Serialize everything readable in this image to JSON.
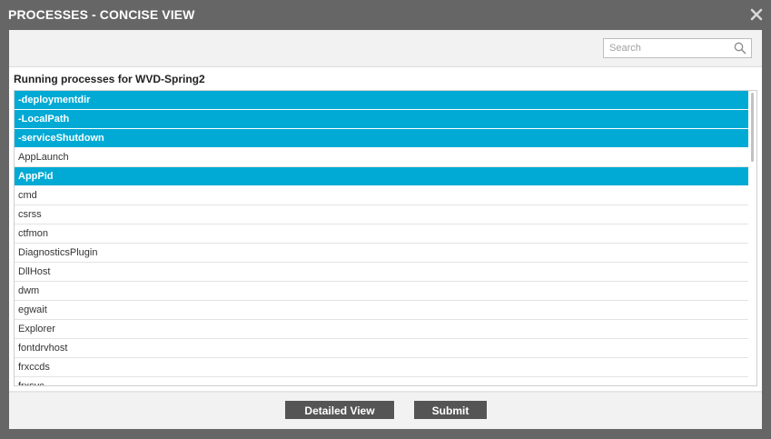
{
  "dialog": {
    "title": "PROCESSES - CONCISE VIEW"
  },
  "search": {
    "placeholder": "Search",
    "value": ""
  },
  "heading": "Running processes for WVD-Spring2",
  "processes": [
    {
      "label": "-deploymentdir",
      "selected": true
    },
    {
      "label": "-LocalPath",
      "selected": true
    },
    {
      "label": "-serviceShutdown",
      "selected": true
    },
    {
      "label": "AppLaunch",
      "selected": false
    },
    {
      "label": "AppPid",
      "selected": true
    },
    {
      "label": "cmd",
      "selected": false
    },
    {
      "label": "csrss",
      "selected": false
    },
    {
      "label": "ctfmon",
      "selected": false
    },
    {
      "label": "DiagnosticsPlugin",
      "selected": false
    },
    {
      "label": "DllHost",
      "selected": false
    },
    {
      "label": "dwm",
      "selected": false
    },
    {
      "label": "egwait",
      "selected": false
    },
    {
      "label": "Explorer",
      "selected": false
    },
    {
      "label": "fontdrvhost",
      "selected": false
    },
    {
      "label": "frxccds",
      "selected": false
    },
    {
      "label": "frxsvc",
      "selected": false
    }
  ],
  "buttons": {
    "detailed_view": "Detailed View",
    "submit": "Submit"
  },
  "icons": {
    "close": "close-icon",
    "search": "search-icon"
  },
  "colors": {
    "selection": "#00aad4",
    "title_bar": "#666666",
    "button": "#555555"
  }
}
